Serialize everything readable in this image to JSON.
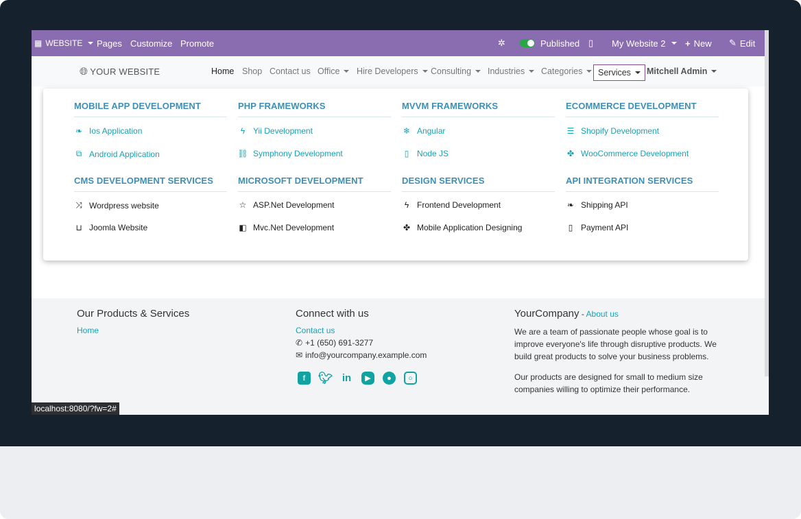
{
  "adminbar": {
    "website_label": "WEBSITE",
    "pages_label": "Pages",
    "customize_label": "Customize",
    "promote_label": "Promote",
    "published_label": "Published",
    "website_select": "My Website 2",
    "new_label": "New",
    "edit_label": "Edit"
  },
  "navbar": {
    "brand": "YOUR WEBSITE",
    "items": {
      "home": "Home",
      "shop": "Shop",
      "contact": "Contact us",
      "office": "Office",
      "hire": "Hire Developers",
      "consulting": "Consulting",
      "industries": "Industries",
      "categories": "Categories",
      "services": "Services",
      "user": "Mitchell Admin"
    }
  },
  "megamenu": {
    "col1": {
      "title1": "MOBILE APP DEVELOPMENT",
      "item1": "Ios Application",
      "item2": "Android Application",
      "title2": "CMS DEVELOPMENT SERVICES",
      "item3": "Wordpress website",
      "item4": "Joomla Website"
    },
    "col2": {
      "title1": "PHP FRAMEWORKS",
      "item1": "Yii Development",
      "item2": "Symphony Development",
      "title2": "MICROSOFT DEVELOPMENT",
      "item3": "ASP.Net Development",
      "item4": "Mvc.Net Development"
    },
    "col3": {
      "title1": "MVVM FRAMEWORKS",
      "item1": "Angular",
      "item2": "Node JS",
      "title2": "DESIGN SERVICES",
      "item3": "Frontend Development",
      "item4": "Mobile Application Designing"
    },
    "col4": {
      "title1": "ECOMMERCE DEVELOPMENT",
      "item1": "Shopify Development",
      "item2": "WooCommerce Development",
      "title2": "API INTEGRATION SERVICES",
      "item3": "Shipping API",
      "item4": "Payment API"
    }
  },
  "footer": {
    "products_title": "Our Products & Services",
    "products_home": "Home",
    "connect_title": "Connect with us",
    "contact_link": "Contact us",
    "phone": "+1 (650) 691-3277",
    "email": "info@yourcompany.example.com",
    "company_name": "YourCompany",
    "company_sep": " - ",
    "about_link": "About us",
    "about_p1": "We are a team of passionate people whose goal is to improve everyone's life through disruptive products. We build great products to solve your business problems.",
    "about_p2": "Our products are designed for small to medium size companies willing to optimize their performance."
  },
  "statusbar": {
    "url": "localhost:8080/?fw=2#"
  },
  "colors": {
    "admin_bar": "#8a6db0",
    "accent": "#17a2b8",
    "heading": "#3e8fb6"
  }
}
